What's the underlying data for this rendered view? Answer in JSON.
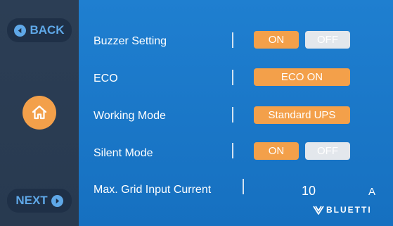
{
  "sidebar": {
    "back_label": "BACK",
    "next_label": "NEXT"
  },
  "settings": {
    "buzzer": {
      "label": "Buzzer Setting",
      "on_label": "ON",
      "off_label": "OFF",
      "state": "on"
    },
    "eco": {
      "label": "ECO",
      "button_label": "ECO ON"
    },
    "working_mode": {
      "label": "Working Mode",
      "value": "Standard UPS"
    },
    "silent": {
      "label": "Silent Mode",
      "on_label": "ON",
      "off_label": "OFF",
      "state": "on"
    },
    "max_grid": {
      "label": "Max. Grid Input Current",
      "value": "10",
      "unit": "A"
    }
  },
  "brand": {
    "name": "BLUETTI"
  },
  "colors": {
    "sidebar_bg": "#2c3e55",
    "main_bg": "#1f7fd0",
    "accent_orange": "#f3a04a",
    "off_grey": "#e3e7ec",
    "nav_blue": "#5fa8e8"
  },
  "icons": {
    "back": "arrow-left-circle-icon",
    "next": "arrow-right-circle-icon",
    "home": "home-icon",
    "brand": "bluetti-logo-icon"
  }
}
